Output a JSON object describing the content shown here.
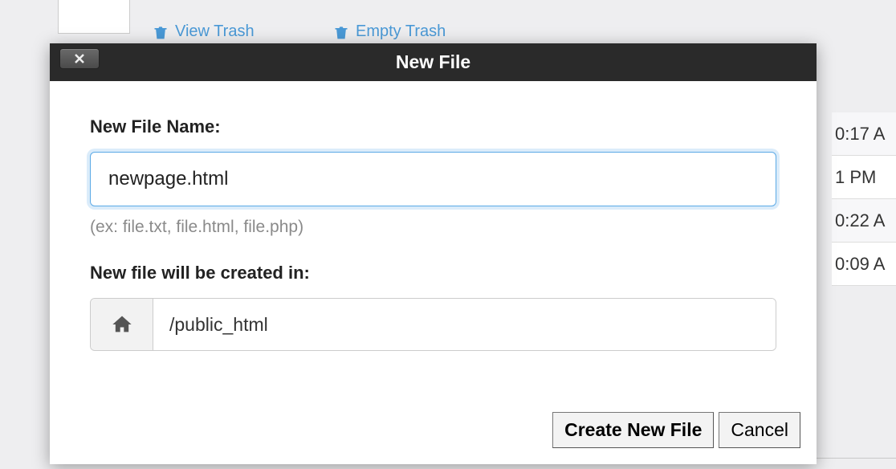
{
  "background": {
    "links": {
      "viewTrash": "View Trash",
      "emptyTrash": "Empty Trash"
    },
    "rows": [
      "0:17 A",
      "1 PM",
      "0:22 A",
      "0:09 A"
    ]
  },
  "dialog": {
    "title": "New File",
    "nameLabel": "New File Name:",
    "nameValue": "newpage.html",
    "hint": "(ex: file.txt, file.html, file.php)",
    "pathLabel": "New file will be created in:",
    "pathValue": "/public_html",
    "createLabel": "Create New File",
    "cancelLabel": "Cancel"
  }
}
